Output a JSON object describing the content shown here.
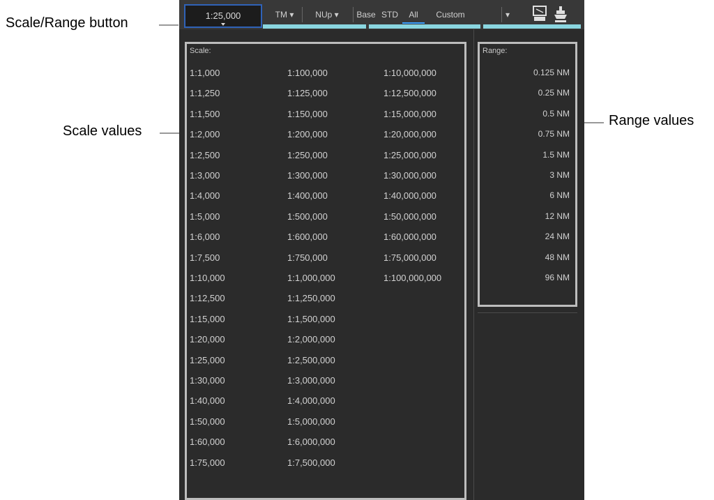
{
  "annotations": {
    "scale_range_button": "Scale/Range button",
    "scale_values": "Scale values",
    "range_values": "Range values"
  },
  "toolbar": {
    "scale_value": "1:25,000",
    "motion_mode": "TM",
    "orientation": "NUp",
    "display_base": "Base",
    "display_std": "STD",
    "display_all": "All",
    "display_custom": "Custom"
  },
  "scale_panel": {
    "title": "Scale:",
    "col1": [
      "1:1,000",
      "1:1,250",
      "1:1,500",
      "1:2,000",
      "1:2,500",
      "1:3,000",
      "1:4,000",
      "1:5,000",
      "1:6,000",
      "1:7,500",
      "1:10,000",
      "1:12,500",
      "1:15,000",
      "1:20,000",
      "1:25,000",
      "1:30,000",
      "1:40,000",
      "1:50,000",
      "1:60,000",
      "1:75,000"
    ],
    "col2": [
      "1:100,000",
      "1:125,000",
      "1:150,000",
      "1:200,000",
      "1:250,000",
      "1:300,000",
      "1:400,000",
      "1:500,000",
      "1:600,000",
      "1:750,000",
      "1:1,000,000",
      "1:1,250,000",
      "1:1,500,000",
      "1:2,000,000",
      "1:2,500,000",
      "1:3,000,000",
      "1:4,000,000",
      "1:5,000,000",
      "1:6,000,000",
      "1:7,500,000"
    ],
    "col3": [
      "1:10,000,000",
      "1:12,500,000",
      "1:15,000,000",
      "1:20,000,000",
      "1:25,000,000",
      "1:30,000,000",
      "1:40,000,000",
      "1:50,000,000",
      "1:60,000,000",
      "1:75,000,000",
      "1:100,000,000"
    ]
  },
  "range_panel": {
    "title": "Range:",
    "values": [
      "0.125 NM",
      "0.25 NM",
      "0.5 NM",
      "0.75 NM",
      "1.5 NM",
      "3 NM",
      "6 NM",
      "12 NM",
      "24 NM",
      "48 NM",
      "96 NM"
    ]
  },
  "colors": {
    "panel_border": "#bdbdbd",
    "background": "#2b2b2b",
    "active_accent": "#3aa0ff"
  }
}
